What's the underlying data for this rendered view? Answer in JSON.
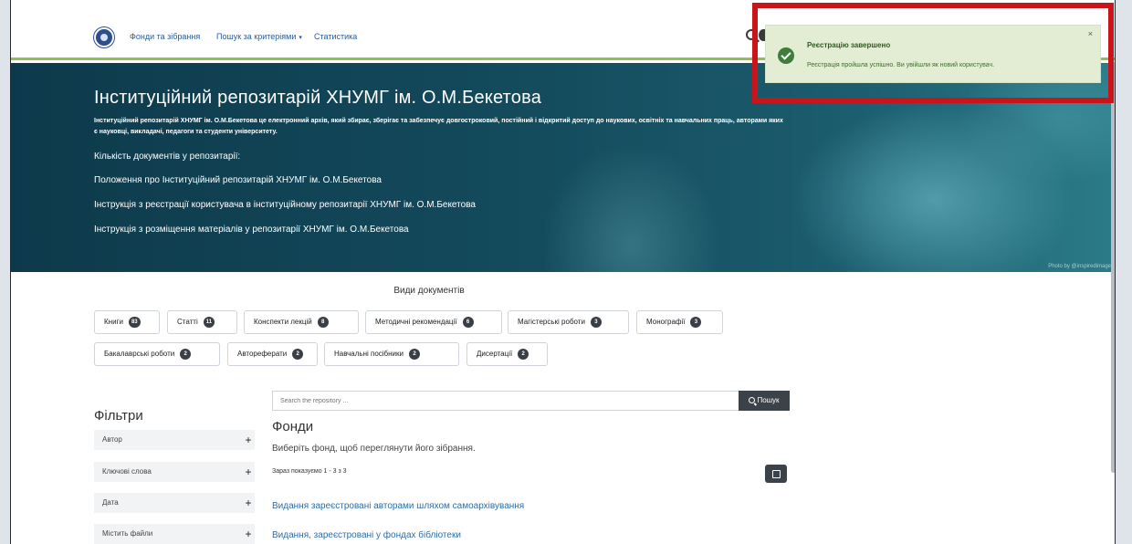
{
  "nav": {
    "links": [
      "Фонди та зібрання",
      "Пошук за критеріями",
      "Статистика"
    ],
    "caret": "▾"
  },
  "hero": {
    "title": "Інституційний репозитарій ХНУМГ ім. О.М.Бекетова",
    "description": "Інституційний репозитарій ХНУМГ ім. О.М.Бекетова це електронний архів, який збирає, зберігає та забезпечує довгостроковий, постійний і відкритий доступ до наукових, освітніх та навчальних праць, авторами яких є науковці, викладачі, педагоги та студенти університету.",
    "count_label": "Кількість документів у репозитарії:",
    "links": [
      "Положення про Інституційний репозитарій ХНУМГ ім. О.М.Бекетова",
      "Інструкція з реєстрації користувача в інституційному репозитарії ХНУМГ ім. О.М.Бекетова",
      "Інструкція з розміщення матеріалів у репозитарії ХНУМГ ім. О.М.Бекетова"
    ],
    "photo_credit": "Photo by @inspiredimages"
  },
  "doc_types": {
    "heading": "Види документів",
    "items": [
      {
        "label": "Книги",
        "count": "83"
      },
      {
        "label": "Статті",
        "count": "11"
      },
      {
        "label": "Конспекти лекцій",
        "count": "8"
      },
      {
        "label": "Методичні рекомендації",
        "count": "6"
      },
      {
        "label": "Магістерські роботи",
        "count": "3"
      },
      {
        "label": "Монографії",
        "count": "3"
      },
      {
        "label": "Бакалаврські роботи",
        "count": "2"
      },
      {
        "label": "Автореферати",
        "count": "2"
      },
      {
        "label": "Навчальні посібники",
        "count": "2"
      },
      {
        "label": "Дисертації",
        "count": "2"
      }
    ]
  },
  "filters": {
    "title": "Фільтри",
    "plus": "+",
    "items": [
      "Автор",
      "Ключові слова",
      "Дата",
      "Містить файли"
    ]
  },
  "search": {
    "placeholder": "Search the repository ...",
    "button": "Пошук"
  },
  "main": {
    "title": "Фонди",
    "subtitle": "Виберіть фонд, щоб переглянути його зібрання.",
    "showing": "Зараз показуємо 1 - 3 з 3",
    "collections": [
      "Видання зареєстровані авторами шляхом самоархівування",
      "Видання, зареєстровані у фондах бібліотеки"
    ]
  },
  "toast": {
    "title": "Реєстрацію завершено",
    "message": "Реєстрація пройшла успішно. Ви увійшли як новий користувач.",
    "close": "×"
  },
  "colors": {
    "highlight": "#c8141a",
    "toast_bg": "#e3edd4",
    "link": "#2b6ea8",
    "nav_accent": "#8fbf5a"
  }
}
